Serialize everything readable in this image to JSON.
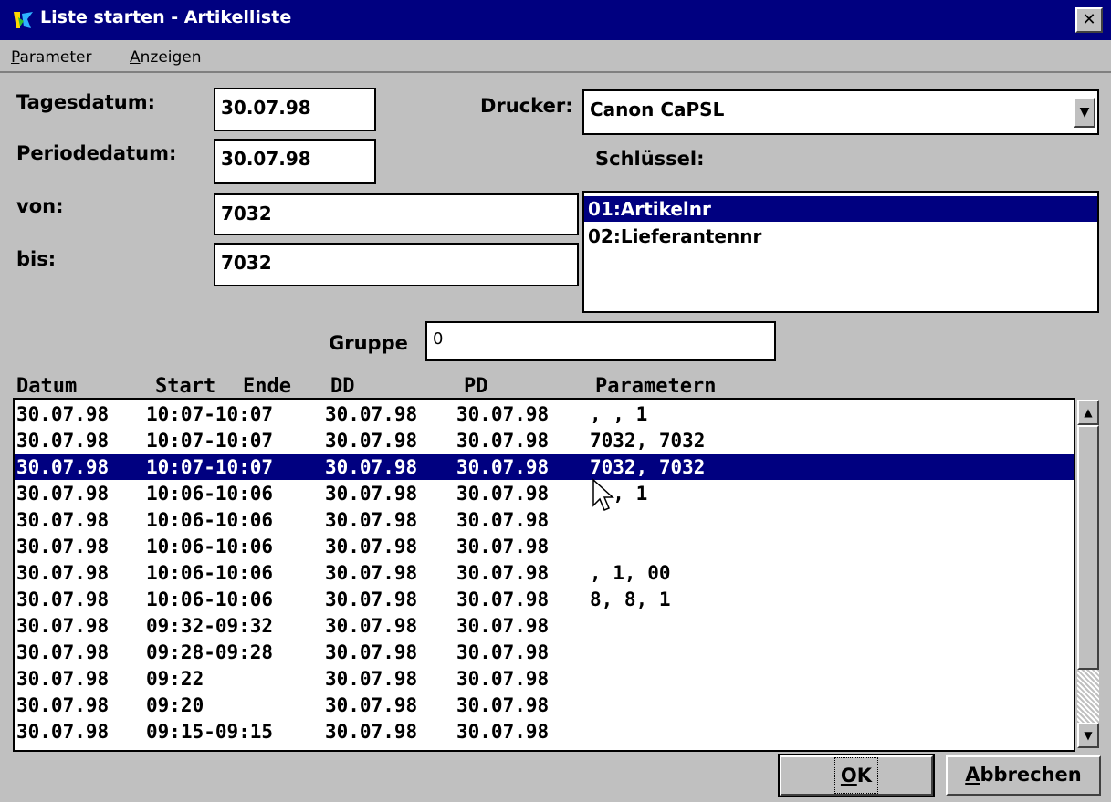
{
  "window": {
    "title": "Liste starten - Artikelliste",
    "close_glyph": "✕"
  },
  "menu": [
    {
      "accel": "P",
      "rest": "arameter"
    },
    {
      "accel": "A",
      "rest": "nzeigen"
    }
  ],
  "form": {
    "tagesdatum_label": "Tagesdatum:",
    "tagesdatum_value": "30.07.98",
    "periodedatum_label": "Periodedatum:",
    "periodedatum_value": "30.07.98",
    "von_label": "von:",
    "von_value": "7032",
    "bis_label": "bis:",
    "bis_value": "7032",
    "drucker_label": "Drucker:",
    "drucker_value": "Canon CaPSL",
    "schluessel_label": "Schlüssel:",
    "schluessel_items": [
      "01:Artikelnr",
      "02:Lieferantennr"
    ],
    "schluessel_selected": 0,
    "gruppe_label": "Gruppe",
    "gruppe_value": "0"
  },
  "history": {
    "columns": [
      "Datum",
      "Start",
      "Ende",
      "DD",
      "PD",
      "Parametern"
    ],
    "rows": [
      {
        "datum": "30.07.98",
        "zeit": "10:07-10:07",
        "dd": "30.07.98",
        "pd": "30.07.98",
        "param": ", , 1"
      },
      {
        "datum": "30.07.98",
        "zeit": "10:07-10:07",
        "dd": "30.07.98",
        "pd": "30.07.98",
        "param": "7032, 7032"
      },
      {
        "datum": "30.07.98",
        "zeit": "10:07-10:07",
        "dd": "30.07.98",
        "pd": "30.07.98",
        "param": "7032, 7032"
      },
      {
        "datum": "30.07.98",
        "zeit": "10:06-10:06",
        "dd": "30.07.98",
        "pd": "30.07.98",
        "param": ", , 1"
      },
      {
        "datum": "30.07.98",
        "zeit": "10:06-10:06",
        "dd": "30.07.98",
        "pd": "30.07.98",
        "param": ""
      },
      {
        "datum": "30.07.98",
        "zeit": "10:06-10:06",
        "dd": "30.07.98",
        "pd": "30.07.98",
        "param": ""
      },
      {
        "datum": "30.07.98",
        "zeit": "10:06-10:06",
        "dd": "30.07.98",
        "pd": "30.07.98",
        "param": ", 1, 00"
      },
      {
        "datum": "30.07.98",
        "zeit": "10:06-10:06",
        "dd": "30.07.98",
        "pd": "30.07.98",
        "param": "8, 8, 1"
      },
      {
        "datum": "30.07.98",
        "zeit": "09:32-09:32",
        "dd": "30.07.98",
        "pd": "30.07.98",
        "param": ""
      },
      {
        "datum": "30.07.98",
        "zeit": "09:28-09:28",
        "dd": "30.07.98",
        "pd": "30.07.98",
        "param": ""
      },
      {
        "datum": "30.07.98",
        "zeit": "09:22",
        "dd": "30.07.98",
        "pd": "30.07.98",
        "param": ""
      },
      {
        "datum": "30.07.98",
        "zeit": "09:20",
        "dd": "30.07.98",
        "pd": "30.07.98",
        "param": ""
      },
      {
        "datum": "30.07.98",
        "zeit": "09:15-09:15",
        "dd": "30.07.98",
        "pd": "30.07.98",
        "param": ""
      }
    ],
    "selected_row": 2
  },
  "buttons": {
    "ok_accel": "O",
    "ok_rest": "K",
    "cancel_accel": "A",
    "cancel_rest": "bbrechen"
  },
  "icons": {
    "app": "app-icon",
    "close": "close-icon",
    "combo": "chevron-down-icon",
    "scroll_up": "scroll-up-icon",
    "scroll_down": "scroll-down-icon",
    "cursor": "mouse-pointer-icon"
  },
  "colors": {
    "titlebar": "#000080",
    "selection": "#000080",
    "face": "#c0c0c0"
  }
}
